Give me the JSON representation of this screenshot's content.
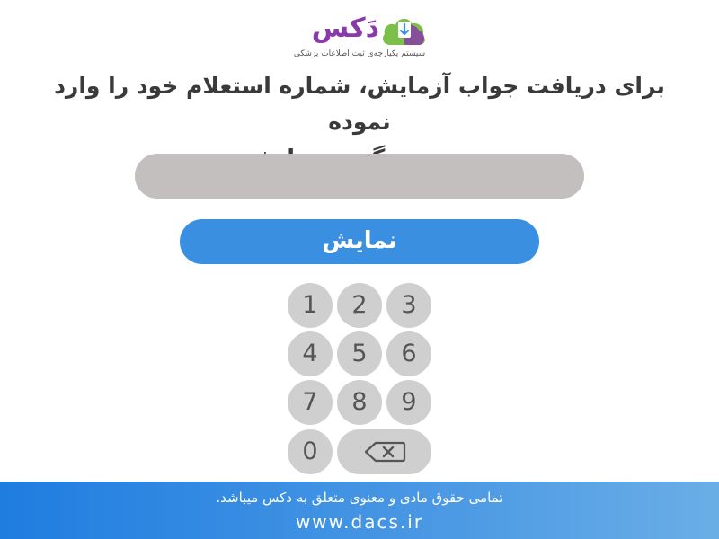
{
  "logo": {
    "wordmark": "دَکس",
    "tagline": "سیستم یکپارچه‌ی ثبت اطلاعات پزشکی",
    "icon": "cloud-document-icon",
    "colors": {
      "purple": "#8a3aa8",
      "green": "#7cc04a",
      "blue": "#3a8fe0"
    }
  },
  "instruction": {
    "line1": "برای دریافت جواب آزمایش، شماره استعلام خود را وارد نموده",
    "line2": "و سپس روی گزینه نمایش بزنید"
  },
  "code_input": {
    "value": "",
    "placeholder": ""
  },
  "show_button": {
    "label": "نمایش"
  },
  "keypad": {
    "keys": [
      "1",
      "2",
      "3",
      "4",
      "5",
      "6",
      "7",
      "8",
      "9",
      "0"
    ],
    "backspace_icon": "backspace-icon"
  },
  "footer": {
    "copyright": "تمامی حقوق مادی و معنوی متعلق به دکس میباشد.",
    "website": "www.dacs.ir"
  },
  "colors": {
    "accent": "#3a8fe0",
    "input_bg": "#c4bfbf",
    "key_bg": "#cfcfcf",
    "footer_start": "#1f7de0",
    "footer_end": "#6aaee6"
  }
}
